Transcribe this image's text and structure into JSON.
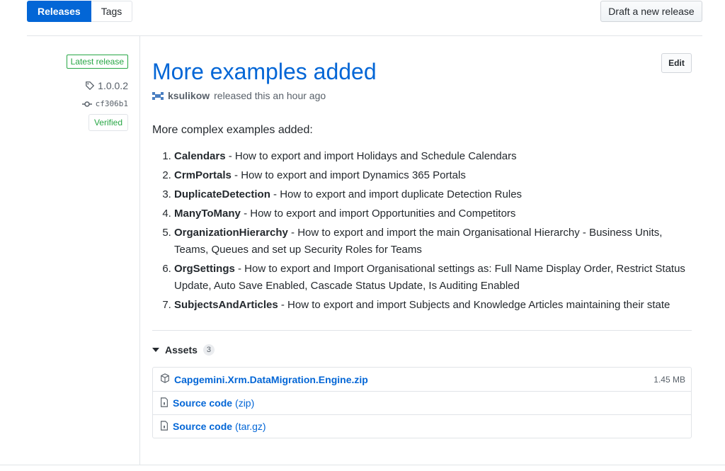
{
  "tabs": [
    {
      "label": "Releases",
      "active": true
    },
    {
      "label": "Tags",
      "active": false
    }
  ],
  "draft_button": "Draft a new release",
  "sidebar": {
    "latest_badge": "Latest release",
    "tag": "1.0.0.2",
    "commit": "cf306b1",
    "verified": "Verified"
  },
  "release": {
    "title": "More examples added",
    "edit_label": "Edit",
    "author": "ksulikow",
    "byline": "released this an hour ago",
    "intro": "More complex examples added:",
    "items": [
      {
        "name": "Calendars",
        "desc": " - How to export and import Holidays and Schedule Calendars"
      },
      {
        "name": "CrmPortals",
        "desc": " - How to export and import Dynamics 365 Portals"
      },
      {
        "name": "DuplicateDetection",
        "desc": " - How to export and import duplicate Detection Rules"
      },
      {
        "name": "ManyToMany",
        "desc": " - How to export and import Opportunities and Competitors"
      },
      {
        "name": "OrganizationHierarchy",
        "desc": " - How to export and import the main Organisational Hierarchy - Business Units, Teams, Queues and set up Security Roles for Teams"
      },
      {
        "name": "OrgSettings",
        "desc": " - How to export and Import Organisational settings as: Full Name Display Order, Restrict Status Update, Auto Save Enabled, Cascade Status Update, Is Auditing Enabled"
      },
      {
        "name": "SubjectsAndArticles",
        "desc": " - How to export and import Subjects and Knowledge Articles maintaining their state"
      }
    ]
  },
  "assets": {
    "label": "Assets",
    "count": "3",
    "files": [
      {
        "name": "Capgemini.Xrm.DataMigration.Engine.zip",
        "suffix": "",
        "size": "1.45 MB",
        "icon": "package-icon"
      },
      {
        "name": "Source code",
        "suffix": "(zip)",
        "size": "",
        "icon": "file-zip-icon"
      },
      {
        "name": "Source code",
        "suffix": "(tar.gz)",
        "size": "",
        "icon": "file-zip-icon"
      }
    ]
  },
  "colors": {
    "accent": "#0366d6",
    "success": "#28a745",
    "text": "#24292e",
    "muted": "#586069",
    "border": "#e1e4e8"
  }
}
